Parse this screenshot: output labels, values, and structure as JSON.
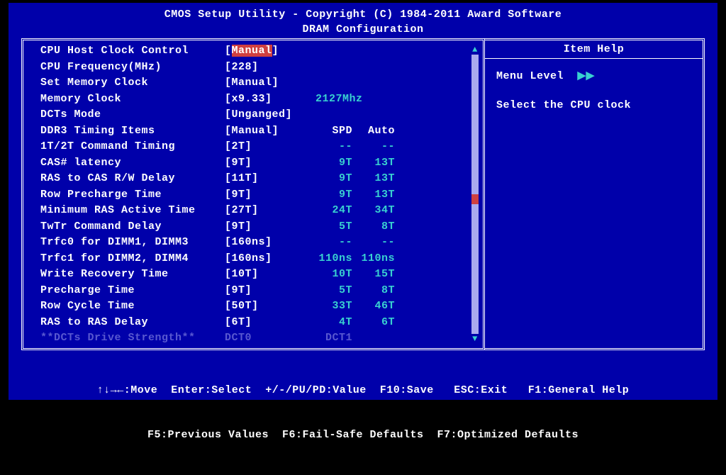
{
  "header": {
    "title": "CMOS Setup Utility - Copyright (C) 1984-2011 Award Software",
    "subtitle": "DRAM Configuration"
  },
  "settings": [
    {
      "label": "CPU Host Clock Control",
      "value": "Manual",
      "spd": "",
      "auto": "",
      "highlighted": true
    },
    {
      "label": "CPU Frequency(MHz)",
      "value": "228",
      "spd": "",
      "auto": ""
    },
    {
      "label": "Set Memory Clock",
      "value": "Manual",
      "spd": "",
      "auto": ""
    },
    {
      "label": "Memory Clock",
      "value": "x9.33",
      "spd": "",
      "auto": "",
      "extra": "2127Mhz"
    },
    {
      "label": "DCTs Mode",
      "value": "Unganged",
      "spd": "",
      "auto": ""
    },
    {
      "label": "DDR3 Timing Items",
      "value": "Manual",
      "spd": "SPD",
      "auto": "Auto",
      "header_cols": true
    },
    {
      "label": "1T/2T Command Timing",
      "value": "2T",
      "spd": "--",
      "auto": "--"
    },
    {
      "label": "CAS# latency",
      "value": "9T",
      "spd": "9T",
      "auto": "13T"
    },
    {
      "label": "RAS to CAS R/W Delay",
      "value": "11T",
      "spd": "9T",
      "auto": "13T"
    },
    {
      "label": "Row Precharge Time",
      "value": "9T",
      "spd": "9T",
      "auto": "13T"
    },
    {
      "label": "Minimum RAS Active Time",
      "value": "27T",
      "spd": "24T",
      "auto": "34T"
    },
    {
      "label": "TwTr Command Delay",
      "value": "9T",
      "spd": "5T",
      "auto": "8T"
    },
    {
      "label": "Trfc0 for DIMM1, DIMM3",
      "value": "160ns",
      "spd": "--",
      "auto": "--"
    },
    {
      "label": "Trfc1 for DIMM2, DIMM4",
      "value": "160ns",
      "spd": "110ns",
      "auto": "110ns"
    },
    {
      "label": "Write Recovery Time",
      "value": "10T",
      "spd": "10T",
      "auto": "15T"
    },
    {
      "label": "Precharge Time",
      "value": "9T",
      "spd": "5T",
      "auto": "8T"
    },
    {
      "label": "Row Cycle Time",
      "value": "50T",
      "spd": "33T",
      "auto": "46T"
    },
    {
      "label": "RAS to RAS Delay",
      "value": "6T",
      "spd": "4T",
      "auto": "6T"
    },
    {
      "label": "**DCTs Drive Strength**",
      "value": "DCT0",
      "spd": "DCT1",
      "auto": "",
      "disabled": true,
      "no_brackets": true
    }
  ],
  "help": {
    "title": "Item Help",
    "menu_level_label": "Menu Level",
    "menu_level_arrows": "▶▶",
    "description": "Select the CPU clock"
  },
  "footer": {
    "line1": "↑↓→←:Move  Enter:Select  +/-/PU/PD:Value  F10:Save   ESC:Exit   F1:General Help",
    "line2": "F5:Previous Values  F6:Fail-Safe Defaults  F7:Optimized Defaults"
  }
}
